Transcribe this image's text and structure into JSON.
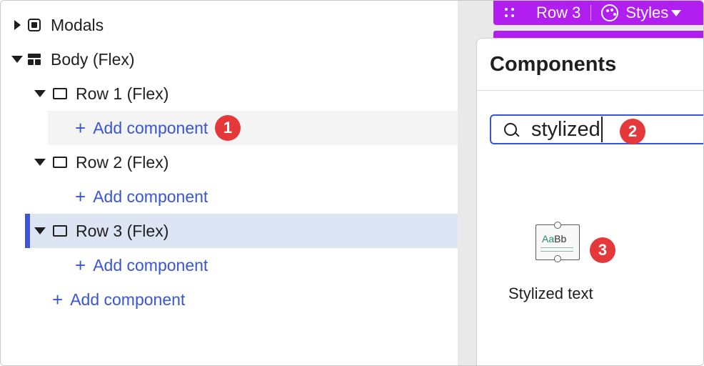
{
  "tree": {
    "items": [
      {
        "label": "Modals"
      },
      {
        "label": "Body (Flex)"
      },
      {
        "label": "Row 1 (Flex)"
      },
      {
        "label": "Add component"
      },
      {
        "label": "Row 2 (Flex)"
      },
      {
        "label": "Add component"
      },
      {
        "label": "Row 3 (Flex)"
      },
      {
        "label": "Add component"
      },
      {
        "label": "Add component"
      }
    ]
  },
  "toolbar": {
    "row_label": "Row 3",
    "styles_label": "Styles"
  },
  "components_panel": {
    "title": "Components",
    "search_value": "stylized",
    "results": [
      {
        "label": "Stylized text",
        "icon": "stylized-text-icon"
      }
    ],
    "tile_icon_text_a": "Aa",
    "tile_icon_text_b": "Bb"
  },
  "badges": [
    "1",
    "2",
    "3"
  ],
  "colors": {
    "accent": "#3a55d1",
    "selection": "#dde5f5",
    "toolbar": "#b01ff0",
    "badge": "#e5383b"
  }
}
